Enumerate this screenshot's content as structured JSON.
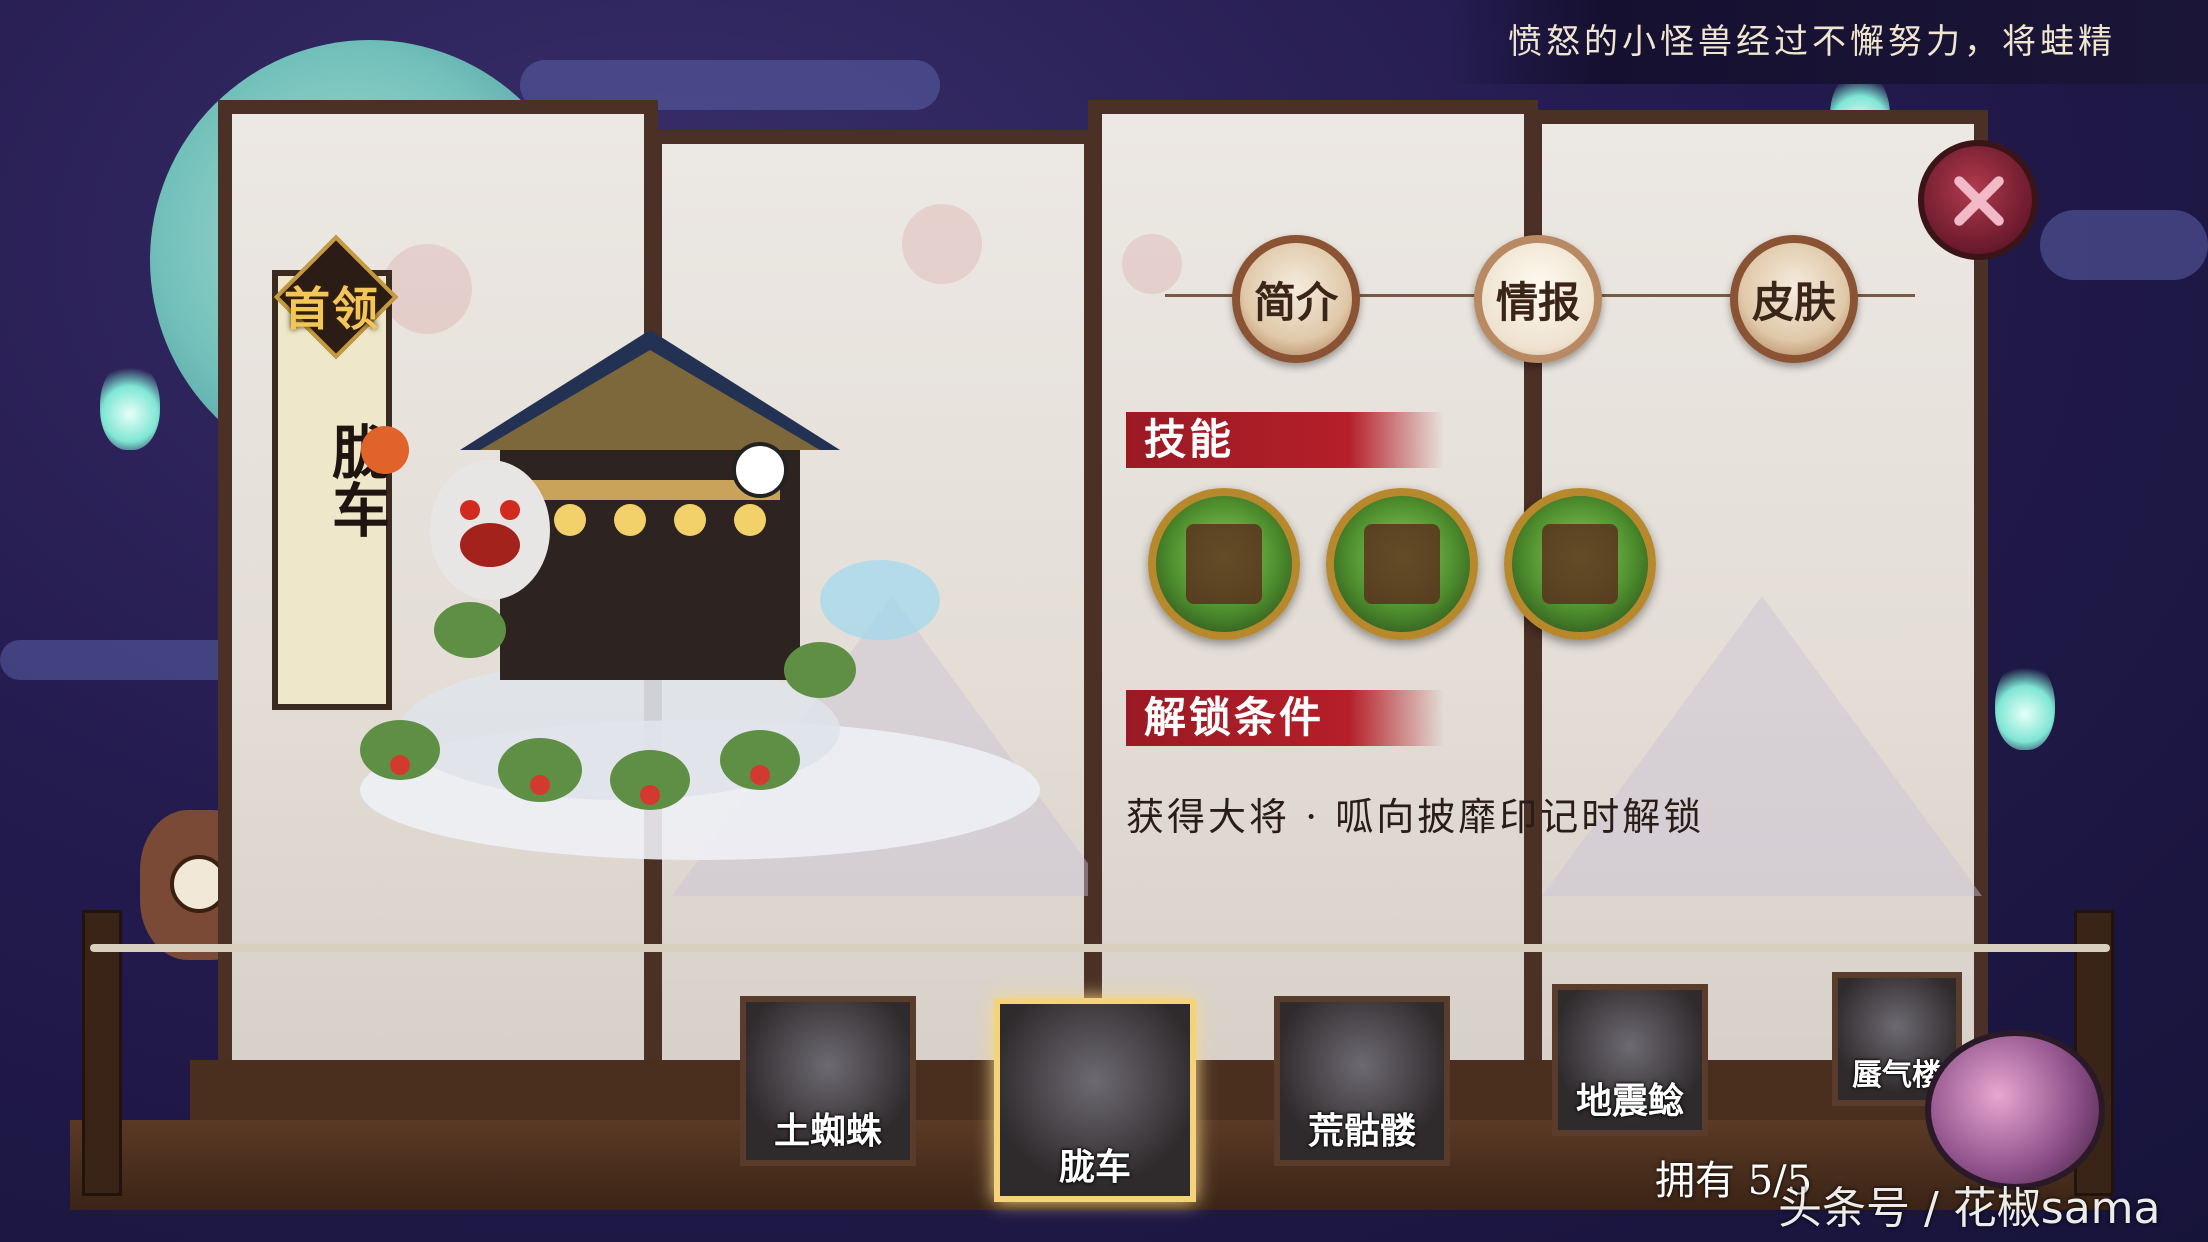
{
  "top_banner": {
    "text": "愤怒的小怪兽经过不懈努力，将蛙精"
  },
  "boss_tag": {
    "rank": "首领",
    "name": "胧车"
  },
  "tabs": [
    {
      "label": "简介",
      "active": false
    },
    {
      "label": "情报",
      "active": true
    },
    {
      "label": "皮肤",
      "active": false
    }
  ],
  "skills_section": {
    "heading": "技能",
    "skills": [
      {
        "icon": "carriage-skill-icon"
      },
      {
        "icon": "frogs-skill-icon"
      },
      {
        "icon": "demon-skill-icon"
      }
    ]
  },
  "unlock_section": {
    "heading": "解锁条件",
    "text": "获得大将 · 呱向披靡印记时解锁"
  },
  "cards": [
    {
      "label": "土蜘蛛",
      "selected": false
    },
    {
      "label": "胧车",
      "selected": true
    },
    {
      "label": "荒骷髅",
      "selected": false
    },
    {
      "label": "地震鲶",
      "selected": false
    },
    {
      "label": "蜃气楼",
      "selected": false
    }
  ],
  "owned_text": "拥有 5/5",
  "watermark": "头条号 / 花椒sama",
  "colors": {
    "heading_red": "#b51f29",
    "frame_brown": "#4a3025",
    "selected_gold": "#f4d37a"
  }
}
